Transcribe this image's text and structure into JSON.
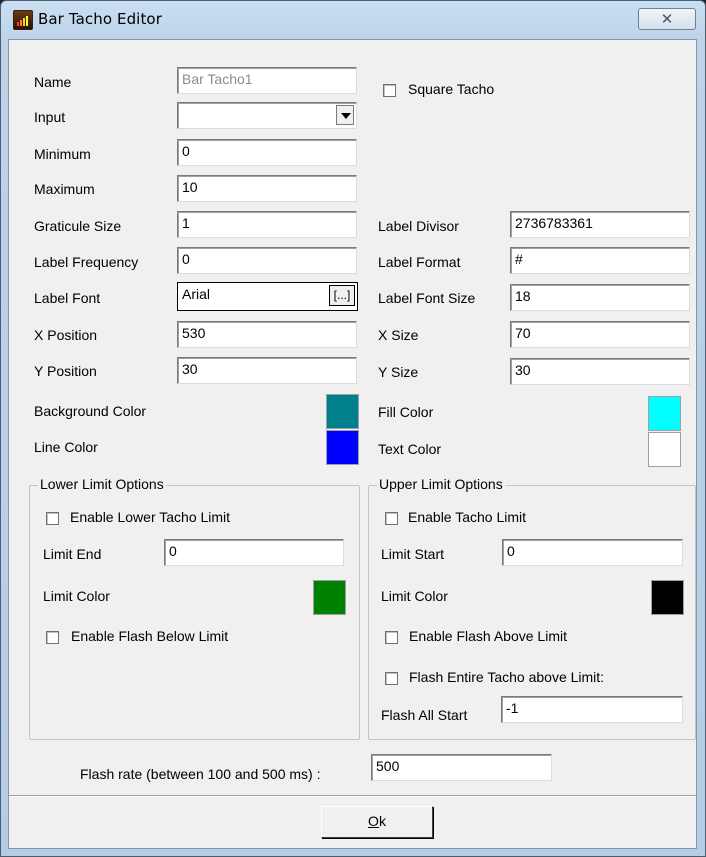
{
  "window": {
    "title": "Bar Tacho Editor",
    "close_glyph": "✕"
  },
  "fields": {
    "name": {
      "label": "Name",
      "value": "Bar Tacho1"
    },
    "input": {
      "label": "Input",
      "value": ""
    },
    "minimum": {
      "label": "Minimum",
      "value": "0"
    },
    "maximum": {
      "label": "Maximum",
      "value": "10"
    },
    "graticule_size": {
      "label": "Graticule Size",
      "value": "1"
    },
    "label_frequency": {
      "label": "Label Frequency",
      "value": "0"
    },
    "label_font": {
      "label": "Label Font",
      "value": "Arial",
      "browse": "[...]"
    },
    "x_position": {
      "label": "X Position",
      "value": "530"
    },
    "y_position": {
      "label": "Y Position",
      "value": "30"
    },
    "label_divisor": {
      "label": "Label Divisor",
      "value": "2736783361"
    },
    "label_format": {
      "label": "Label Format",
      "value": "#"
    },
    "label_font_size": {
      "label": "Label Font Size",
      "value": "18"
    },
    "x_size": {
      "label": "X Size",
      "value": "70"
    },
    "y_size": {
      "label": "Y Size",
      "value": "30"
    }
  },
  "square_tacho": {
    "label": "Square Tacho",
    "checked": false
  },
  "colors": {
    "background": {
      "label": "Background Color",
      "hex": "#00808a"
    },
    "line": {
      "label": "Line Color",
      "hex": "#0000ff"
    },
    "fill": {
      "label": "Fill Color",
      "hex": "#00ffff"
    },
    "text": {
      "label": "Text Color",
      "hex": "#ffffff"
    }
  },
  "lower_limit": {
    "title": "Lower Limit Options",
    "enable_label": "Enable Lower Tacho Limit",
    "limit_end_label": "Limit End",
    "limit_end_value": "0",
    "limit_color_label": "Limit Color",
    "limit_color_hex": "#008000",
    "flash_below_label": "Enable Flash Below Limit"
  },
  "upper_limit": {
    "title": "Upper Limit Options",
    "enable_label": "Enable Tacho Limit",
    "limit_start_label": "Limit Start",
    "limit_start_value": "0",
    "limit_color_label": "Limit Color",
    "limit_color_hex": "#000000",
    "flash_above_label": "Enable Flash Above Limit",
    "flash_entire_label": "Flash Entire Tacho above Limit:",
    "flash_all_start_label": "Flash All Start",
    "flash_all_start_value": "-1"
  },
  "flash_rate": {
    "label": "Flash rate (between 100 and 500 ms) :",
    "value": "500"
  },
  "ok_button": {
    "mnemonic": "O",
    "rest": "k"
  }
}
